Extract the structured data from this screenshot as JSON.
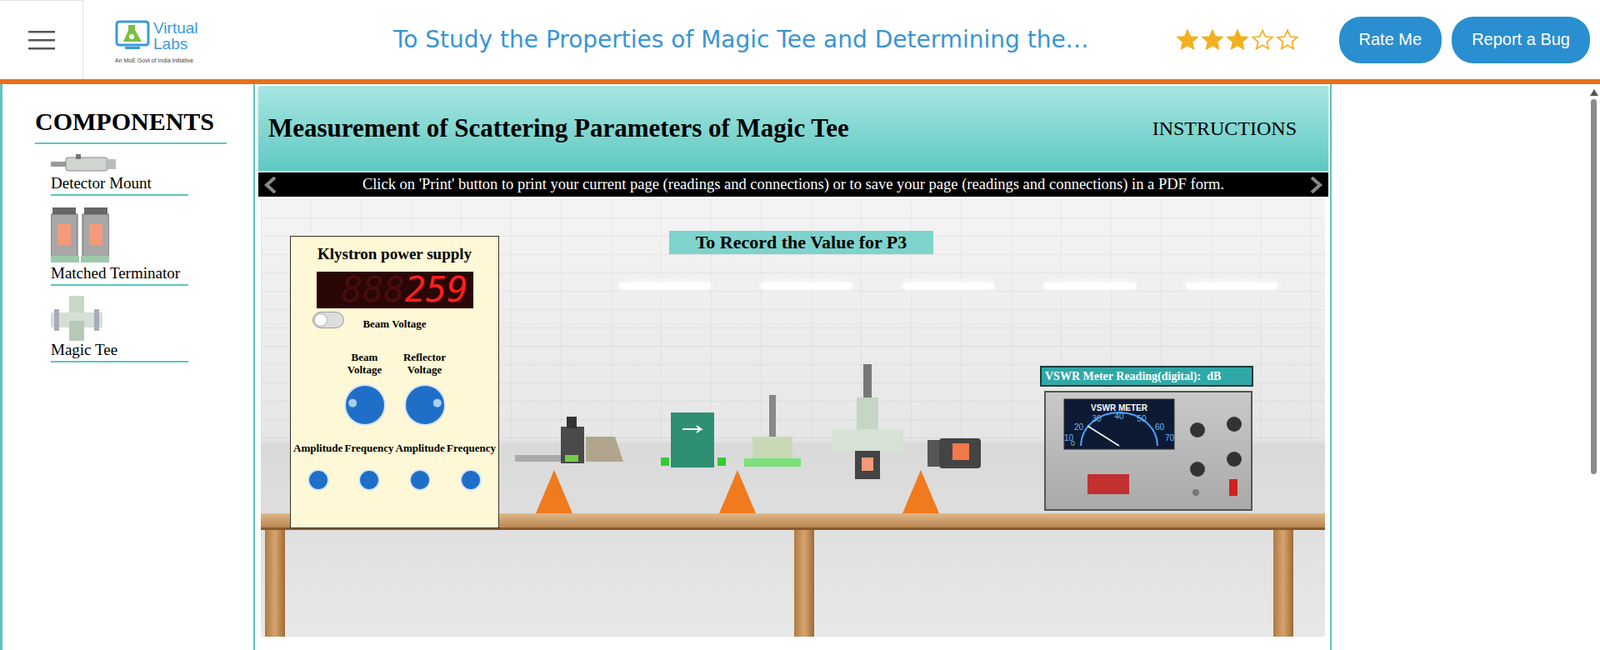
{
  "logo": {
    "line1": "Virtual",
    "line2": "Labs",
    "tagline": "An MoE Govt of India Initiative"
  },
  "page_title": "To Study the Properties of Magic Tee and Determining the…",
  "rating": {
    "stars": 3,
    "max": 5
  },
  "buttons": [
    "Rate Me",
    "Report a Bug"
  ],
  "components": {
    "heading": "COMPONENTS",
    "items": [
      {
        "label": "Detector Mount",
        "kind": "detector"
      },
      {
        "label": "Matched Terminator",
        "kind": "terminator"
      },
      {
        "label": "Magic Tee",
        "kind": "tee"
      }
    ]
  },
  "simulation": {
    "title": "Measurement of Scattering Parameters of Magic Tee",
    "instructions": "INSTRUCTIONS",
    "ticker": "Click on 'Print' button to print your current page (readings and connections) or to save your page (readings and connections) in a PDF form.",
    "step": "To Record the Value for P3"
  },
  "klystron": {
    "title": "Klystron power supply",
    "display": "259",
    "display_ghost": "888",
    "display_label": "Beam Voltage",
    "power_on": false,
    "knobs": [
      {
        "label": "Beam Voltage",
        "level": 0.2
      },
      {
        "label": "Reflector Voltage",
        "level": 0.8
      }
    ],
    "small_knobs": [
      {
        "label": "Amplitude"
      },
      {
        "label": "Frequency"
      },
      {
        "label": "Amplitude"
      },
      {
        "label": "Frequency"
      }
    ]
  },
  "vswr": {
    "reading_label": "VSWR Meter Reading(digital):",
    "reading": "",
    "unit": "dB",
    "meter_title": "VSWR METER",
    "scale": [
      "10",
      "20",
      "30",
      "40",
      "50",
      "60",
      "70"
    ],
    "zero": "0"
  }
}
